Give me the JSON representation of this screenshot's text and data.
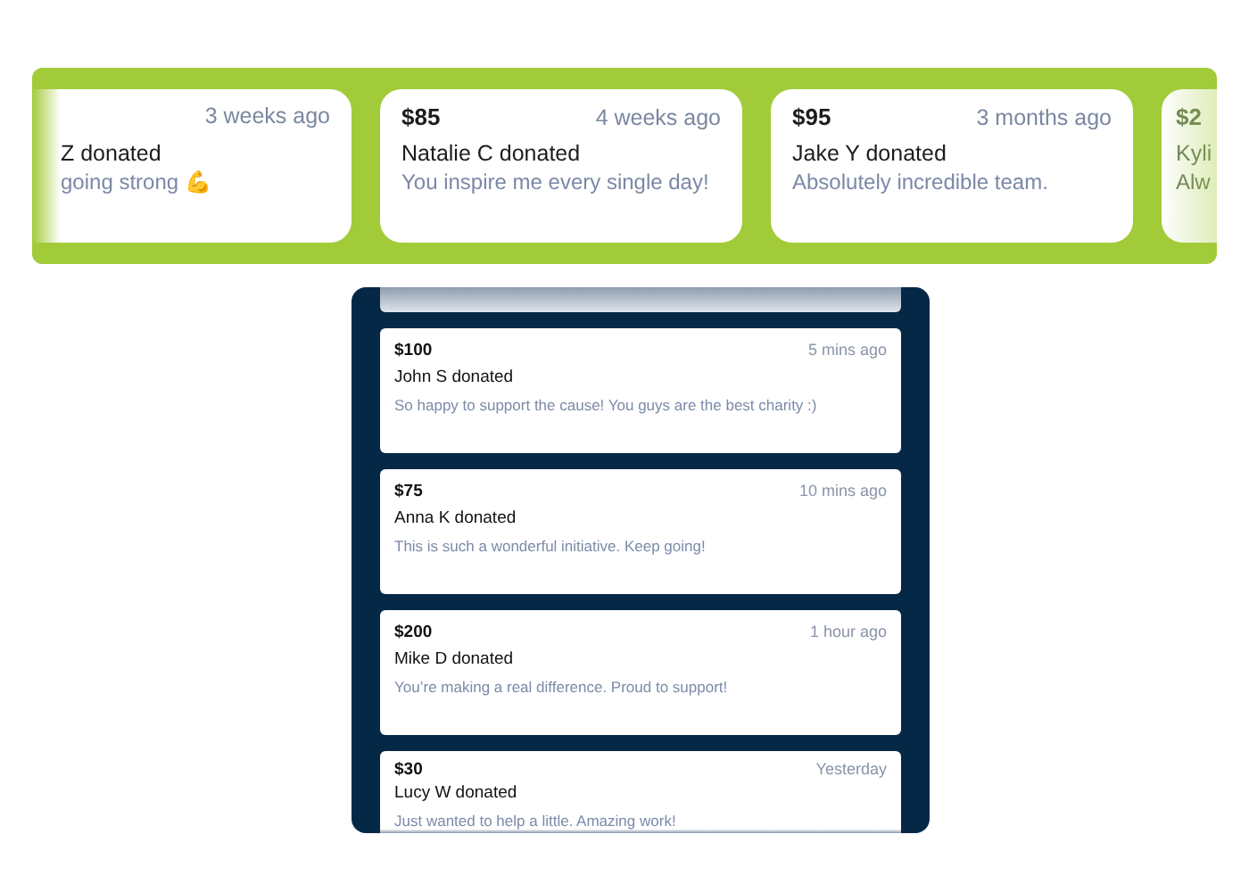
{
  "featured_strip": {
    "donations": [
      {
        "donor": "Z donated",
        "message": "going strong 💪",
        "time": "3 weeks ago"
      },
      {
        "amount": "$85",
        "donor": "Natalie C donated",
        "message": "You inspire me every single day!",
        "time": "4 weeks ago"
      },
      {
        "amount": "$95",
        "donor": "Jake Y donated",
        "message": "Absolutely incredible team.",
        "time": "3 months ago"
      },
      {
        "amount": "$2",
        "donor": "Kyli",
        "message": "Alw"
      }
    ]
  },
  "recent_feed": {
    "donations": [
      {
        "amount": "$100",
        "donor": "John S donated",
        "message": "So happy to support the cause! You guys are the best charity :)",
        "time": "5 mins ago"
      },
      {
        "amount": "$75",
        "donor": "Anna K donated",
        "message": "This is such a wonderful initiative. Keep going!",
        "time": "10 mins ago"
      },
      {
        "amount": "$200",
        "donor": "Mike D donated",
        "message": "You’re making a real difference. Proud to support!",
        "time": "1 hour ago"
      },
      {
        "amount": "$30",
        "donor": "Lucy W donated",
        "message": "Just wanted to help a little. Amazing work!",
        "time": "Yesterday"
      }
    ]
  }
}
